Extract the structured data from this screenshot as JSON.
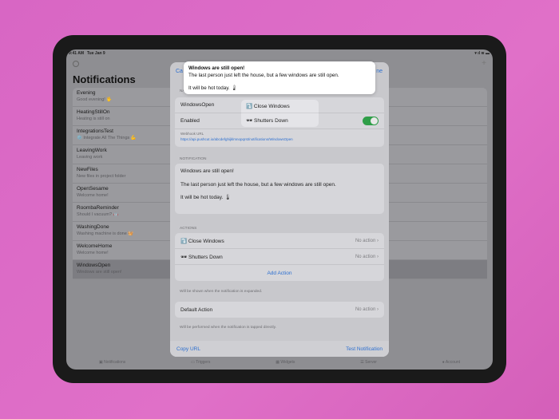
{
  "status": {
    "time": "9:41 AM",
    "date": "Tue Jan 9"
  },
  "sidebar": {
    "title": "Notifications",
    "items": [
      {
        "name": "Evening",
        "subtitle": "Good evening! 🖖"
      },
      {
        "name": "HeatingStillOn",
        "subtitle": "Heating is still on"
      },
      {
        "name": "IntegrationsTest",
        "subtitle": "⚙️ Integrate All The Things 💪"
      },
      {
        "name": "LeavingWork",
        "subtitle": "Leaving work"
      },
      {
        "name": "NewFiles",
        "subtitle": "New files in project folder"
      },
      {
        "name": "OpenSesame",
        "subtitle": "Welcome home!"
      },
      {
        "name": "RoombaReminder",
        "subtitle": "Should I vacuum? 🤖"
      },
      {
        "name": "WashingDone",
        "subtitle": "Washing machine is done 🧺"
      },
      {
        "name": "WelcomeHome",
        "subtitle": "Welcome home!"
      },
      {
        "name": "WindowsOpen",
        "subtitle": "Windows are still open!"
      }
    ]
  },
  "tabbar": [
    "Notifications",
    "Triggers",
    "Widgets",
    "Server",
    "Account"
  ],
  "modal": {
    "cancel": "Ca",
    "done": "ne",
    "name_section": "NA",
    "name": "WindowsOpen",
    "enabled_label": "Enabled",
    "enabled": true,
    "webhook_label": "Webhook URL",
    "webhook_url": "https://api.pushcut.io/abcdefghijklmnopqrst/notifications/WindowsOpen",
    "notification_section": "NOTIFICATION",
    "notif_title": "Windows are still open!",
    "notif_body": "The last person just left the house, but a few windows are still open.",
    "notif_extra": "It will be hot today. 🌡",
    "actions_section": "ACTIONS",
    "actions": [
      {
        "label": "⤵️ Close Windows",
        "value": "No action"
      },
      {
        "label": "🕶 Shutters Down",
        "value": "No action"
      }
    ],
    "add_action": "Add Action",
    "actions_note": "Will be shown when the notification is expanded.",
    "default_action": "Default Action",
    "default_value": "No action",
    "default_note": "Will be performed when the notification is tapped directly.",
    "copy_url": "Copy URL",
    "test": "Test Notification"
  },
  "banner": {
    "title": "Windows are still open!",
    "body": "The last person just left the house, but a few windows are still open.",
    "extra": "It will be hot today. 🌡"
  },
  "menu": [
    "⤵️ Close Windows",
    "🕶 Shutters Down"
  ]
}
